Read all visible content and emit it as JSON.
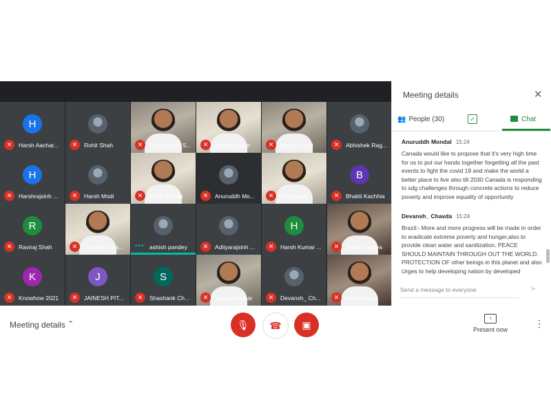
{
  "tiles": [
    {
      "name": "Harsh Aacharya",
      "short": "Harsh Aachar...",
      "letter": "H",
      "color": "#1a73e8",
      "kind": "letter"
    },
    {
      "name": "Rohit Shah",
      "short": "Rohit Shah",
      "kind": "photo"
    },
    {
      "name": "Prathviraj M Shah",
      "short": "Prathviraj M S...",
      "kind": "video",
      "v": "v1"
    },
    {
      "name": "aastha thaker",
      "short": "aastha thaker",
      "kind": "video",
      "v": "v2"
    },
    {
      "name": "Manav Joshi",
      "short": "Manav Joshi",
      "kind": "video",
      "v": "v1"
    },
    {
      "name": "Abhishek Rag",
      "short": "Abhishek Rag...",
      "kind": "photo"
    },
    {
      "name": "Harshrajsinh",
      "short": "Harshrajsinh ...",
      "letter": "H",
      "color": "#1a73e8",
      "kind": "letter"
    },
    {
      "name": "Harsh Modi",
      "short": "Harsh Modi",
      "kind": "photo"
    },
    {
      "name": "Ishan Mohite",
      "short": "Ishan Mohite",
      "kind": "video",
      "v": "v2"
    },
    {
      "name": "Anuruddh Mondal",
      "short": "Anuruddh Mo...",
      "kind": "photo",
      "dark": true
    },
    {
      "name": "ketul patel",
      "short": "ketul patel",
      "kind": "video",
      "v": "v2"
    },
    {
      "name": "Bhakti Kachhia",
      "short": "Bhakti Kachhia",
      "letter": "B",
      "color": "#5e35b1",
      "kind": "letter"
    },
    {
      "name": "Raviraj Shah",
      "short": "Raviraj Shah",
      "letter": "R",
      "color": "#1e8e3e",
      "kind": "letter"
    },
    {
      "name": "Saurabh Chavda",
      "short": "Saurabh Cha...",
      "kind": "video",
      "v": "v2"
    },
    {
      "name": "ashish pandey",
      "short": "ashish pandey",
      "kind": "photo",
      "speaking": true
    },
    {
      "name": "Adityarajsinh",
      "short": "Adityarajsinh ...",
      "kind": "photo"
    },
    {
      "name": "Harsh Kumar",
      "short": "Harsh Kumar ...",
      "letter": "H",
      "color": "#1e8e3e",
      "kind": "letter"
    },
    {
      "name": "Sheel Pandya",
      "short": "Sheel Pandya",
      "kind": "video",
      "v": "v3"
    },
    {
      "name": "Knowhow 2021",
      "short": "Knowhow 2021",
      "letter": "K",
      "color": "#9c27b0",
      "kind": "letter"
    },
    {
      "name": "JAINESH PIT",
      "short": "JAINESH PIT...",
      "letter": "J",
      "color": "#7e57c2",
      "kind": "letter"
    },
    {
      "name": "Shashank Ch",
      "short": "Shashank Ch...",
      "letter": "S",
      "color": "#00695c",
      "kind": "letter"
    },
    {
      "name": "swayam jathar",
      "short": "swayam jathar",
      "kind": "video",
      "v": "v1"
    },
    {
      "name": "Devansh_ Chavda",
      "short": "Devansh_ Ch...",
      "kind": "photo"
    },
    {
      "name": "Isha Prasad",
      "short": "Isha Prasad",
      "kind": "video",
      "v": "v3"
    }
  ],
  "panel": {
    "title": "Meeting details",
    "people_tab": "People (30)",
    "chat_tab": "Chat",
    "messages": [
      {
        "sender": "Anuruddh Mondal",
        "time": "15:24",
        "text": "Canada would like to propose that it's very high time for us to put our hands together forgetting all the past events to fight the covid 19 and make the world a better place to live also till 2030 Canada is responding to sdg challenges through concrete actions to reduce poverty and improve equality of opportunity"
      },
      {
        "sender": "Devansh_ Chavda",
        "time": "15:24",
        "text": "Brazil:- More and more progress will be made in order to eradicate extreme poverty and hunger,also to provide clean water and sanitization.  PEACE SHOULD MAINTAIN THROUGH OUT THE WORLD. PROTECTION OF other beings in this planet and also Urges to help developing nation by developed"
      }
    ],
    "input_placeholder": "Send a message to everyone"
  },
  "controls": {
    "meeting_details": "Meeting details",
    "present_now": "Present now"
  },
  "icons": [
    "mic-off-icon",
    "hang-up-icon",
    "camera-off-icon",
    "present-icon",
    "more-vert-icon",
    "close-icon",
    "people-icon",
    "check-icon",
    "chat-icon",
    "send-icon"
  ]
}
